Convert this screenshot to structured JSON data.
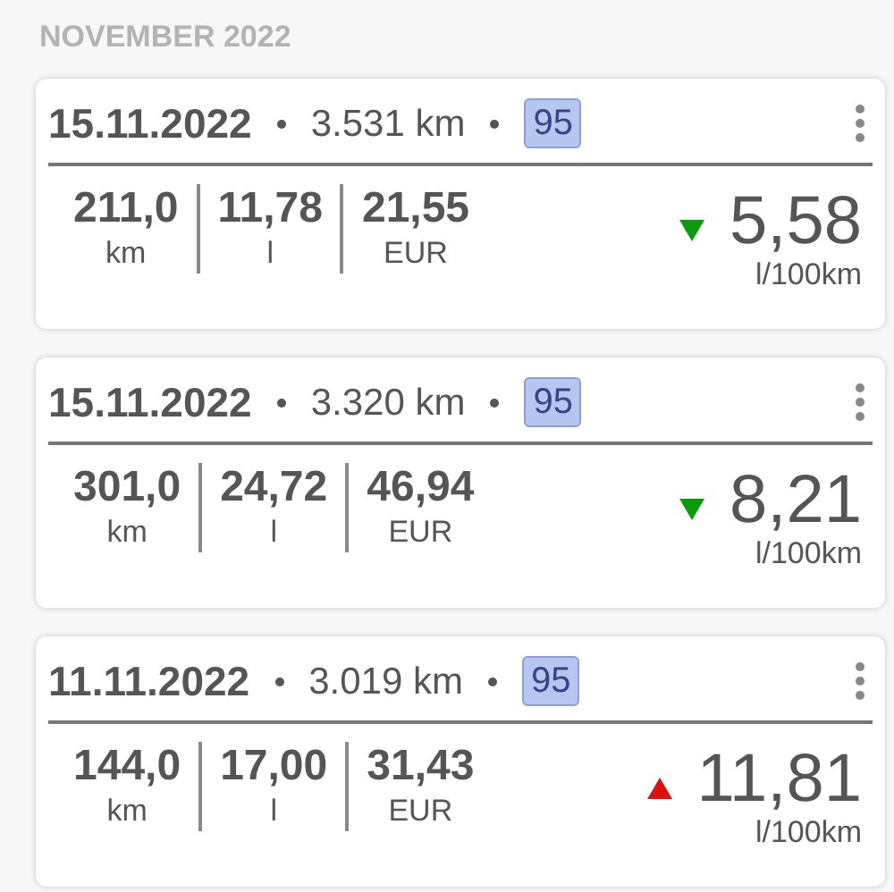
{
  "section_title": "NOVEMBER 2022",
  "entries": [
    {
      "date": "15.11.2022",
      "odometer": "3.531 km",
      "fuel_type": "95",
      "stats": [
        {
          "value": "211,0",
          "unit": "km"
        },
        {
          "value": "11,78",
          "unit": "l"
        },
        {
          "value": "21,55",
          "unit": "EUR"
        }
      ],
      "kind": "down",
      "consumption": "5,58",
      "consumption_unit": "l/100km"
    },
    {
      "date": "15.11.2022",
      "odometer": "3.320 km",
      "fuel_type": "95",
      "stats": [
        {
          "value": "301,0",
          "unit": "km"
        },
        {
          "value": "24,72",
          "unit": "l"
        },
        {
          "value": "46,94",
          "unit": "EUR"
        }
      ],
      "kind": "down",
      "consumption": "8,21",
      "consumption_unit": "l/100km"
    },
    {
      "date": "11.11.2022",
      "odometer": "3.019 km",
      "fuel_type": "95",
      "stats": [
        {
          "value": "144,0",
          "unit": "km"
        },
        {
          "value": "17,00",
          "unit": "l"
        },
        {
          "value": "31,43",
          "unit": "EUR"
        }
      ],
      "kind": "up",
      "consumption": "11,81",
      "consumption_unit": "l/100km"
    }
  ]
}
